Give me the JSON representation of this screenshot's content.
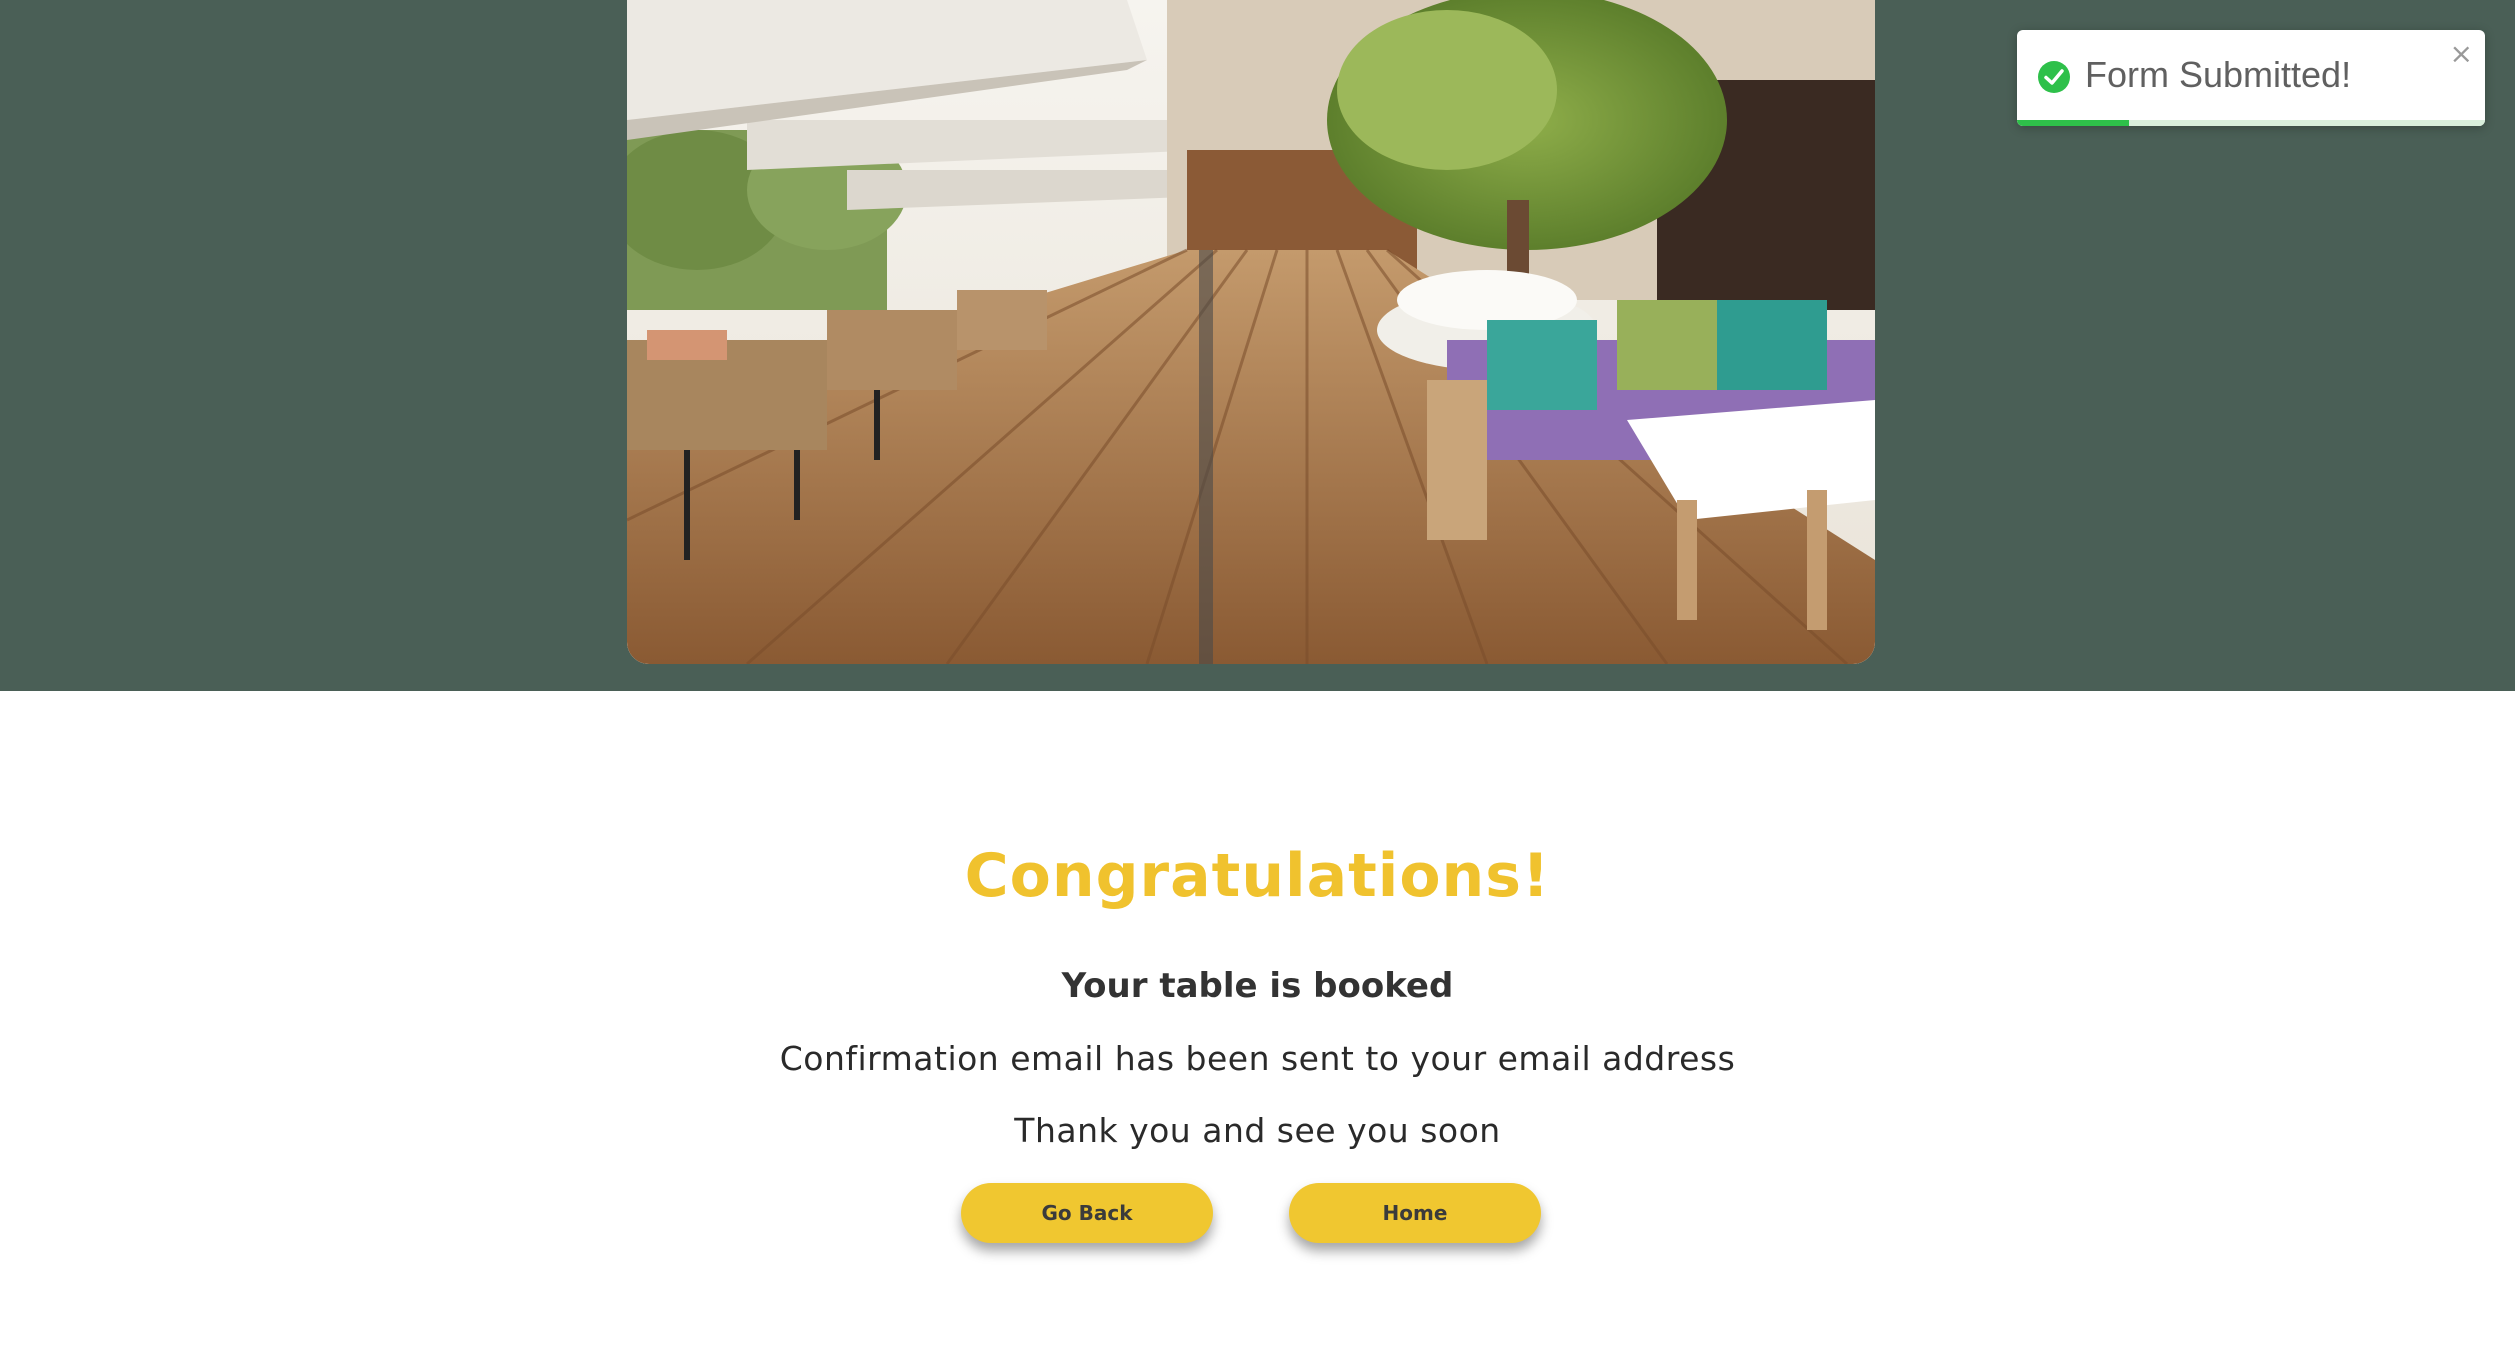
{
  "hero": {
    "background_color": "#4a5f56",
    "image_alt": "restaurant terrace with wooden deck, lounge seating and a tree"
  },
  "confirmation": {
    "headline": "Congratulations!",
    "subheadline": "Your table is booked",
    "message_1": "Confirmation email has been sent to your email address",
    "message_2": "Thank you and see you soon",
    "headline_color": "#f0c22e"
  },
  "buttons": {
    "go_back_label": "Go Back",
    "home_label": "Home",
    "color": "#f0c730"
  },
  "toast": {
    "message": "Form Submitted!",
    "icon": "check-circle-icon",
    "close_icon": "close-icon",
    "progress_fraction": 0.24,
    "accent_color": "#2ec04a"
  }
}
